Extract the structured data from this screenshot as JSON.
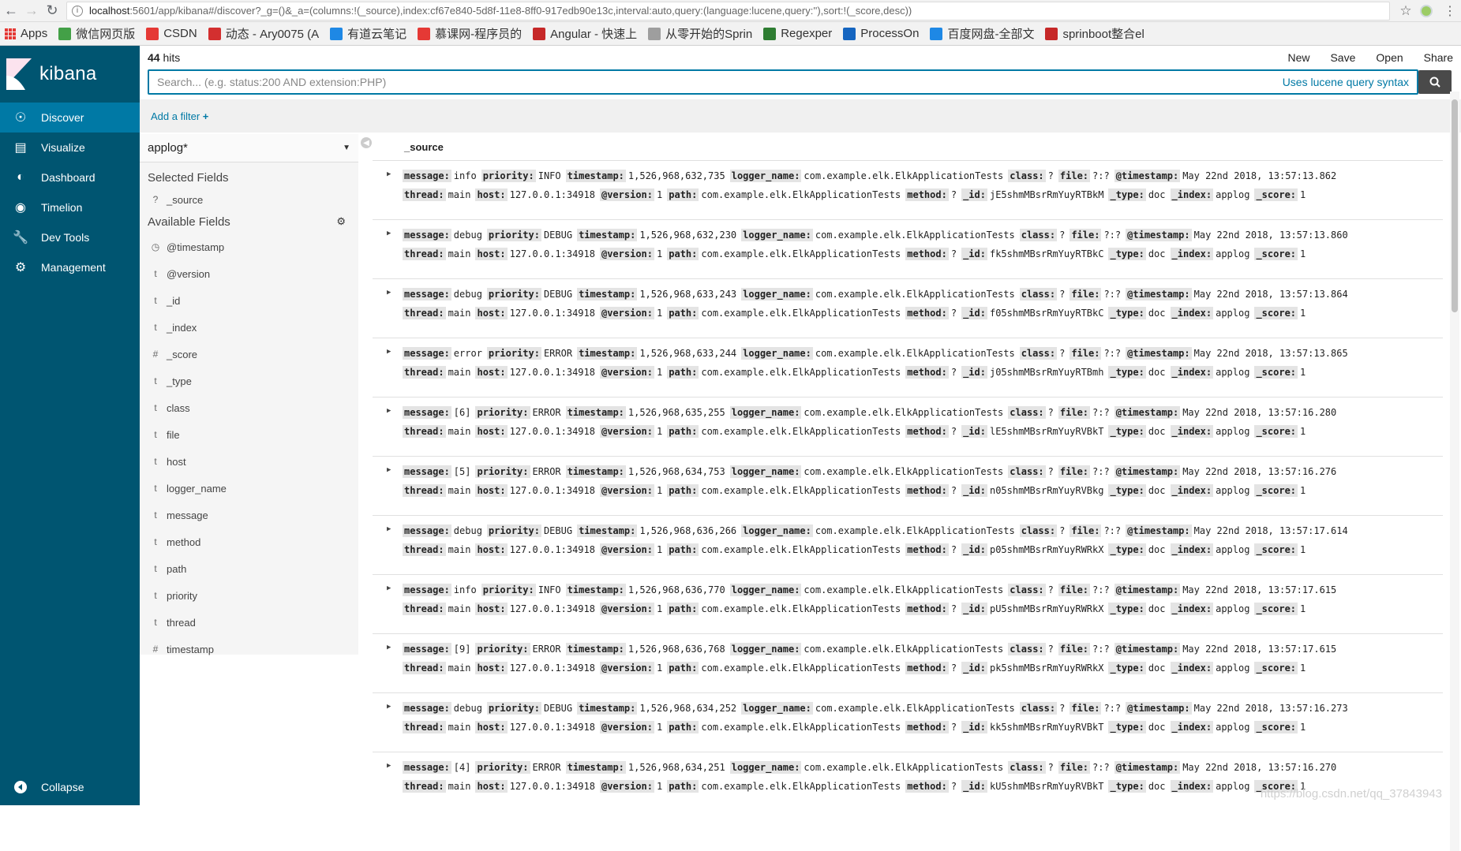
{
  "browser": {
    "url_host": "localhost",
    "url_rest": ":5601/app/kibana#/discover?_g=()&_a=(columns:!(_source),index:cf67e840-5d8f-11e8-8ff0-917edb90e13c,interval:auto,query:(language:lucene,query:''),sort:!(_score,desc))"
  },
  "bookmarks": [
    {
      "label": "Apps",
      "icon_color": "#e53935"
    },
    {
      "label": "微信网页版",
      "icon_color": "#43a047"
    },
    {
      "label": "CSDN",
      "icon_color": "#e53935"
    },
    {
      "label": "动态 - Ary0075 (A",
      "icon_color": "#d32f2f"
    },
    {
      "label": "有道云笔记",
      "icon_color": "#1e88e5"
    },
    {
      "label": "慕课网-程序员的",
      "icon_color": "#e53935"
    },
    {
      "label": "Angular - 快速上",
      "icon_color": "#c62828"
    },
    {
      "label": "从零开始的Sprin",
      "icon_color": "#9e9e9e"
    },
    {
      "label": "Regexper",
      "icon_color": "#2e7d32"
    },
    {
      "label": "ProcessOn",
      "icon_color": "#1565c0"
    },
    {
      "label": "百度网盘-全部文",
      "icon_color": "#1e88e5"
    },
    {
      "label": "sprinboot整合el",
      "icon_color": "#c62828"
    }
  ],
  "brand": {
    "name": "kibana"
  },
  "nav": [
    {
      "label": "Discover",
      "icon": "compass-icon",
      "active": true
    },
    {
      "label": "Visualize",
      "icon": "bar-chart-icon"
    },
    {
      "label": "Dashboard",
      "icon": "dashboard-icon"
    },
    {
      "label": "Timelion",
      "icon": "timelion-icon"
    },
    {
      "label": "Dev Tools",
      "icon": "wrench-icon"
    },
    {
      "label": "Management",
      "icon": "gear-icon"
    }
  ],
  "collapse_label": "Collapse",
  "hits": {
    "count": "44",
    "label": "hits"
  },
  "top_actions": [
    "New",
    "Save",
    "Open",
    "Share"
  ],
  "search": {
    "placeholder": "Search... (e.g. status:200 AND extension:PHP)",
    "syntax_link": "Uses lucene query syntax"
  },
  "add_filter": "Add a filter",
  "index_pattern": "applog*",
  "selected_fields_title": "Selected Fields",
  "selected_fields": [
    {
      "type": "?",
      "name": "_source"
    }
  ],
  "available_fields_title": "Available Fields",
  "available_fields": [
    {
      "type": "◷",
      "name": "@timestamp"
    },
    {
      "type": "t",
      "name": "@version"
    },
    {
      "type": "t",
      "name": "_id"
    },
    {
      "type": "t",
      "name": "_index"
    },
    {
      "type": "#",
      "name": "_score"
    },
    {
      "type": "t",
      "name": "_type"
    },
    {
      "type": "t",
      "name": "class"
    },
    {
      "type": "t",
      "name": "file"
    },
    {
      "type": "t",
      "name": "host"
    },
    {
      "type": "t",
      "name": "logger_name"
    },
    {
      "type": "t",
      "name": "message"
    },
    {
      "type": "t",
      "name": "method"
    },
    {
      "type": "t",
      "name": "path"
    },
    {
      "type": "t",
      "name": "priority"
    },
    {
      "type": "t",
      "name": "thread"
    },
    {
      "type": "#",
      "name": "timestamp"
    }
  ],
  "column_header": "_source",
  "documents": [
    {
      "message": "info",
      "priority": "INFO",
      "timestamp": "1,526,968,632,735",
      "logger_name": "com.example.elk.ElkApplicationTests",
      "class": "?",
      "file": "?:?",
      "at_timestamp": "May 22nd 2018, 13:57:13.862",
      "thread": "main",
      "host": "127.0.0.1:34918",
      "version": "1",
      "path": "com.example.elk.ElkApplicationTests",
      "method": "?",
      "id": "jE5shmMBsrRmYuyRTBkM",
      "type": "doc",
      "index": "applog",
      "score": "1"
    },
    {
      "message": "debug",
      "priority": "DEBUG",
      "timestamp": "1,526,968,632,230",
      "logger_name": "com.example.elk.ElkApplicationTests",
      "class": "?",
      "file": "?:?",
      "at_timestamp": "May 22nd 2018, 13:57:13.860",
      "thread": "main",
      "host": "127.0.0.1:34918",
      "version": "1",
      "path": "com.example.elk.ElkApplicationTests",
      "method": "?",
      "id": "fk5shmMBsrRmYuyRTBkC",
      "type": "doc",
      "index": "applog",
      "score": "1"
    },
    {
      "message": "debug",
      "priority": "DEBUG",
      "timestamp": "1,526,968,633,243",
      "logger_name": "com.example.elk.ElkApplicationTests",
      "class": "?",
      "file": "?:?",
      "at_timestamp": "May 22nd 2018, 13:57:13.864",
      "thread": "main",
      "host": "127.0.0.1:34918",
      "version": "1",
      "path": "com.example.elk.ElkApplicationTests",
      "method": "?",
      "id": "f05shmMBsrRmYuyRTBkC",
      "type": "doc",
      "index": "applog",
      "score": "1"
    },
    {
      "message": "error",
      "priority": "ERROR",
      "timestamp": "1,526,968,633,244",
      "logger_name": "com.example.elk.ElkApplicationTests",
      "class": "?",
      "file": "?:?",
      "at_timestamp": "May 22nd 2018, 13:57:13.865",
      "thread": "main",
      "host": "127.0.0.1:34918",
      "version": "1",
      "path": "com.example.elk.ElkApplicationTests",
      "method": "?",
      "id": "j05shmMBsrRmYuyRTBmh",
      "type": "doc",
      "index": "applog",
      "score": "1"
    },
    {
      "message": "[6]",
      "priority": "ERROR",
      "timestamp": "1,526,968,635,255",
      "logger_name": "com.example.elk.ElkApplicationTests",
      "class": "?",
      "file": "?:?",
      "at_timestamp": "May 22nd 2018, 13:57:16.280",
      "thread": "main",
      "host": "127.0.0.1:34918",
      "version": "1",
      "path": "com.example.elk.ElkApplicationTests",
      "method": "?",
      "id": "lE5shmMBsrRmYuyRVBkT",
      "type": "doc",
      "index": "applog",
      "score": "1"
    },
    {
      "message": "[5]",
      "priority": "ERROR",
      "timestamp": "1,526,968,634,753",
      "logger_name": "com.example.elk.ElkApplicationTests",
      "class": "?",
      "file": "?:?",
      "at_timestamp": "May 22nd 2018, 13:57:16.276",
      "thread": "main",
      "host": "127.0.0.1:34918",
      "version": "1",
      "path": "com.example.elk.ElkApplicationTests",
      "method": "?",
      "id": "n05shmMBsrRmYuyRVBkg",
      "type": "doc",
      "index": "applog",
      "score": "1"
    },
    {
      "message": "debug",
      "priority": "DEBUG",
      "timestamp": "1,526,968,636,266",
      "logger_name": "com.example.elk.ElkApplicationTests",
      "class": "?",
      "file": "?:?",
      "at_timestamp": "May 22nd 2018, 13:57:17.614",
      "thread": "main",
      "host": "127.0.0.1:34918",
      "version": "1",
      "path": "com.example.elk.ElkApplicationTests",
      "method": "?",
      "id": "p05shmMBsrRmYuyRWRkX",
      "type": "doc",
      "index": "applog",
      "score": "1"
    },
    {
      "message": "info",
      "priority": "INFO",
      "timestamp": "1,526,968,636,770",
      "logger_name": "com.example.elk.ElkApplicationTests",
      "class": "?",
      "file": "?:?",
      "at_timestamp": "May 22nd 2018, 13:57:17.615",
      "thread": "main",
      "host": "127.0.0.1:34918",
      "version": "1",
      "path": "com.example.elk.ElkApplicationTests",
      "method": "?",
      "id": "pU5shmMBsrRmYuyRWRkX",
      "type": "doc",
      "index": "applog",
      "score": "1"
    },
    {
      "message": "[9]",
      "priority": "ERROR",
      "timestamp": "1,526,968,636,768",
      "logger_name": "com.example.elk.ElkApplicationTests",
      "class": "?",
      "file": "?:?",
      "at_timestamp": "May 22nd 2018, 13:57:17.615",
      "thread": "main",
      "host": "127.0.0.1:34918",
      "version": "1",
      "path": "com.example.elk.ElkApplicationTests",
      "method": "?",
      "id": "pk5shmMBsrRmYuyRWRkX",
      "type": "doc",
      "index": "applog",
      "score": "1"
    },
    {
      "message": "debug",
      "priority": "DEBUG",
      "timestamp": "1,526,968,634,252",
      "logger_name": "com.example.elk.ElkApplicationTests",
      "class": "?",
      "file": "?:?",
      "at_timestamp": "May 22nd 2018, 13:57:16.273",
      "thread": "main",
      "host": "127.0.0.1:34918",
      "version": "1",
      "path": "com.example.elk.ElkApplicationTests",
      "method": "?",
      "id": "kk5shmMBsrRmYuyRVBkT",
      "type": "doc",
      "index": "applog",
      "score": "1"
    },
    {
      "message": "[4]",
      "priority": "ERROR",
      "timestamp": "1,526,968,634,251",
      "logger_name": "com.example.elk.ElkApplicationTests",
      "class": "?",
      "file": "?:?",
      "at_timestamp": "May 22nd 2018, 13:57:16.270",
      "thread": "main",
      "host": "127.0.0.1:34918",
      "version": "1",
      "path": "com.example.elk.ElkApplicationTests",
      "method": "?",
      "id": "kU5shmMBsrRmYuyRVBkT",
      "type": "doc",
      "index": "applog",
      "score": "1"
    }
  ],
  "watermark": "https://blog.csdn.net/qq_37843943",
  "colors": {
    "sidebar": "#005571",
    "active": "#0079a5",
    "link": "#0079a5"
  }
}
